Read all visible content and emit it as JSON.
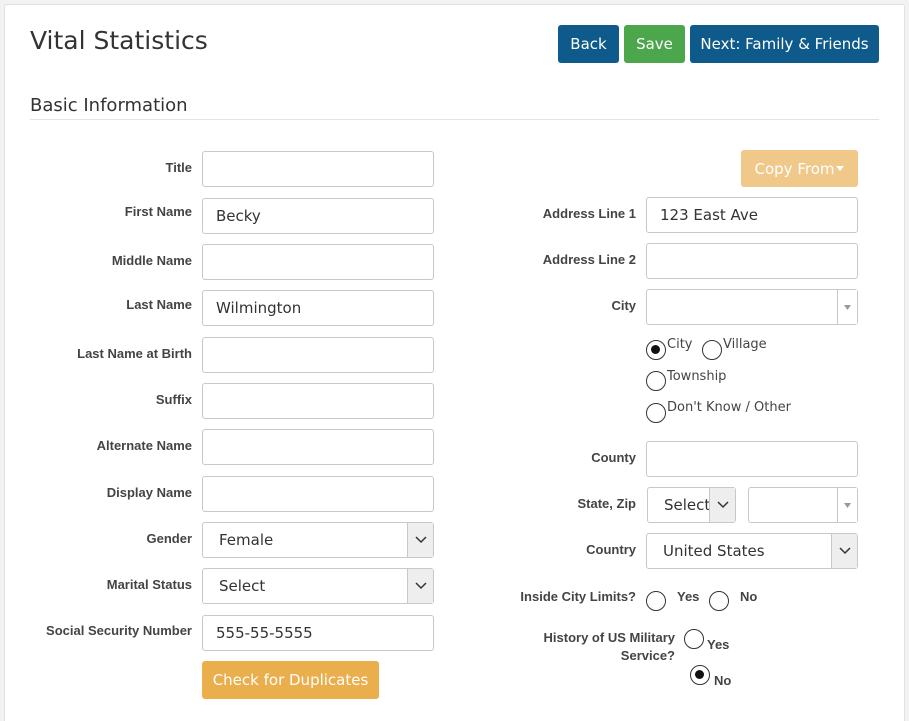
{
  "header": {
    "title": "Vital Statistics",
    "back_label": "Back",
    "save_label": "Save",
    "next_label": "Next: Family & Friends"
  },
  "section": {
    "title": "Basic Information"
  },
  "left_form": {
    "title_label": "Title",
    "title_value": "",
    "first_name_label": "First Name",
    "first_name_value": "Becky",
    "middle_name_label": "Middle Name",
    "middle_name_value": "",
    "last_name_label": "Last Name",
    "last_name_value": "Wilmington",
    "birth_last_name_label": "Last Name at Birth",
    "birth_last_name_value": "",
    "suffix_label": "Suffix",
    "suffix_value": "",
    "alternate_name_label": "Alternate Name",
    "alternate_name_value": "",
    "display_name_label": "Display Name",
    "display_name_value": "",
    "gender_label": "Gender",
    "gender_value": "Female",
    "marital_status_label": "Marital Status",
    "marital_status_value": "Select",
    "ssn_label": "Social Security Number",
    "ssn_value": "555-55-5555",
    "check_duplicates_label": "Check for Duplicates"
  },
  "right_form": {
    "copy_from_label": "Copy From",
    "address1_label": "Address Line 1",
    "address1_value": "123 East Ave",
    "address2_label": "Address Line 2",
    "address2_value": "",
    "city_label": "City",
    "city_value": "",
    "municipality_options": [
      {
        "label": "City",
        "checked": true
      },
      {
        "label": "Village",
        "checked": false
      },
      {
        "label": "Township",
        "checked": false
      },
      {
        "label": "Don't Know / Other",
        "checked": false
      }
    ],
    "county_label": "County",
    "county_value": "",
    "state_zip_label": "State, Zip",
    "state_value": "Select",
    "zip_value": "",
    "country_label": "Country",
    "country_value": "United States",
    "inside_city_label": "Inside City Limits?",
    "inside_city_yes": "Yes",
    "inside_city_no": "No",
    "military_label_line1": "History of US Military",
    "military_label_line2": "Service?",
    "military_yes": "Yes",
    "military_no": "No"
  },
  "icons": {
    "dropdown": "chevron-down-icon",
    "caret": "caret-down-icon"
  },
  "colors": {
    "primary": "#0e5a8a",
    "success": "#4ca64c",
    "warning": "#eaae4c",
    "warning_light": "#f0c98a"
  }
}
